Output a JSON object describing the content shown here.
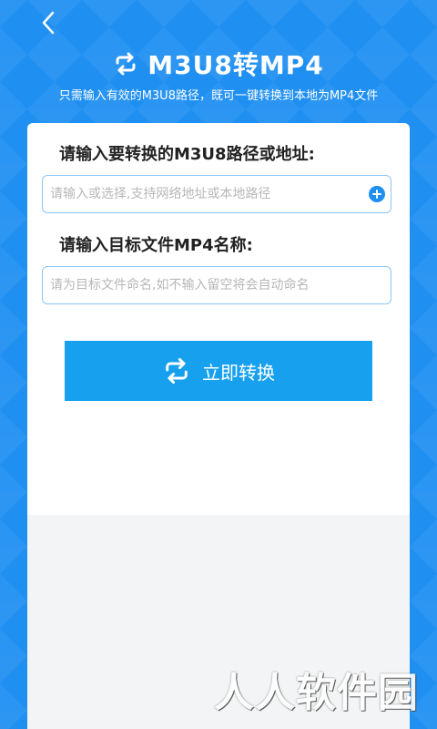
{
  "header": {
    "title": "M3U8转MP4",
    "subtitle": "只需输入有效的M3U8路径，既可一键转换到本地为MP4文件"
  },
  "form": {
    "source_label": "请输入要转换的M3U8路径或地址:",
    "source_placeholder": "请输入或选择,支持网络地址或本地路径",
    "source_value": "",
    "target_label": "请输入目标文件MP4名称:",
    "target_placeholder": "请为目标文件命名,如不输入留空将会自动命名",
    "target_value": "",
    "convert_label": "立即转换"
  },
  "watermark": "人人软件园",
  "icons": {
    "back": "chevron-left-icon",
    "title": "convert-arrows-icon",
    "add": "plus-circle-icon",
    "convert": "convert-arrows-icon"
  },
  "colors": {
    "primary": "#1e8ff0",
    "button": "#16a0ee",
    "card": "#ffffff",
    "input_border": "#8cc6f4"
  }
}
